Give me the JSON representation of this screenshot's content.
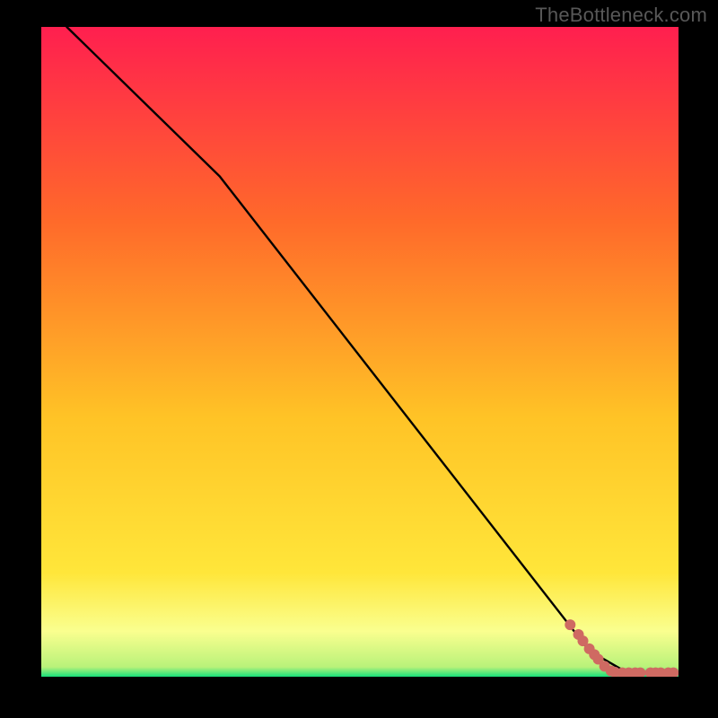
{
  "watermark": "TheBottleneck.com",
  "colors": {
    "background": "#000000",
    "gradient_top": "#ff1f4f",
    "gradient_mid1": "#ff6a2a",
    "gradient_mid2": "#ffc326",
    "gradient_mid3": "#ffe63a",
    "gradient_bottom_band": "#faff8f",
    "gradient_green": "#17e07a",
    "line": "#000000",
    "marker": "#cf6a62"
  },
  "chart_data": {
    "type": "line",
    "title": "",
    "xlabel": "",
    "ylabel": "",
    "xlim": [
      0,
      100
    ],
    "ylim": [
      0,
      100
    ],
    "grid": false,
    "legend": false,
    "series": [
      {
        "name": "curve",
        "x": [
          4,
          28,
          86,
          92,
          100
        ],
        "y": [
          100,
          77,
          4,
          0.6,
          0.6
        ]
      }
    ],
    "markers": {
      "name": "points",
      "x": [
        83,
        84.3,
        85,
        86,
        86.8,
        87.4,
        88.4,
        89.4,
        90,
        91.2,
        92.2,
        93.2,
        94,
        95.6,
        96.4,
        97.2,
        98.4,
        99.2
      ],
      "y": [
        8,
        6.5,
        5.5,
        4.3,
        3.4,
        2.7,
        1.6,
        0.9,
        0.7,
        0.6,
        0.6,
        0.6,
        0.6,
        0.6,
        0.6,
        0.6,
        0.6,
        0.6
      ]
    }
  }
}
